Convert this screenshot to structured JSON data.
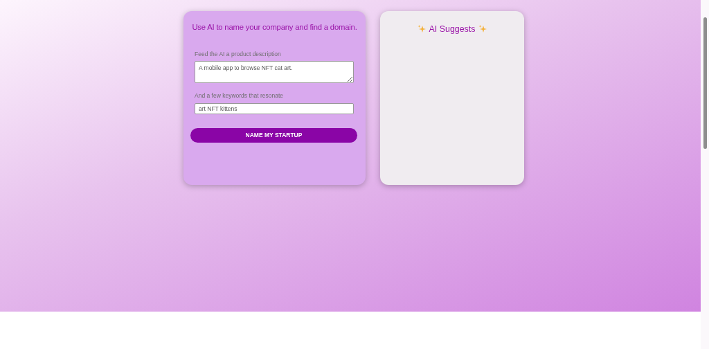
{
  "form_card": {
    "title": "Use AI to name your company and find a domain.",
    "description_label": "Feed the AI a product description",
    "description_value": "A mobile app to browse NFT cat art.",
    "keywords_label": "And a few keywords that resonate",
    "keywords_value": "art NFT kittens",
    "submit_button": "NAME MY STARTUP"
  },
  "results_card": {
    "title": "AI Suggests"
  }
}
